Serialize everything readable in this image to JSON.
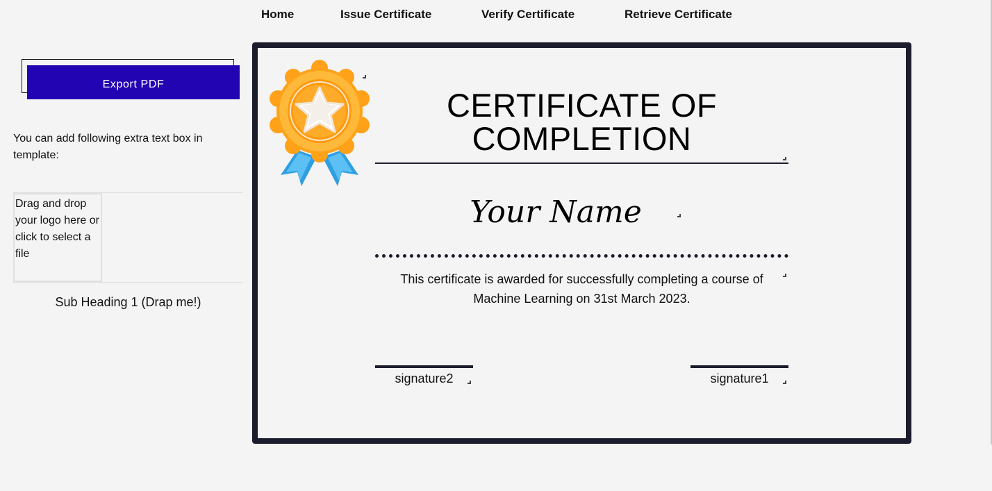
{
  "nav": {
    "home": "Home",
    "issue": "Issue Certificate",
    "verify": "Verify Certificate",
    "retrieve": "Retrieve Certificate"
  },
  "sidebar": {
    "export_label": "Export PDF",
    "note": "You can add following extra text box in template:",
    "dropzone_text": "Drag and drop your logo here or click to select a file",
    "subheading": "Sub Heading 1 (Drap me!)"
  },
  "certificate": {
    "badge_icon": "medal-star-badge",
    "title": "CERTIFICATE OF COMPLETION",
    "name": "Your Name",
    "body": "This certificate is awarded for successfully completing a course of Machine Learning on 31st March 2023.",
    "signature_left": "signature2",
    "signature_right": "signature1"
  },
  "colors": {
    "accent_button": "#2304b3",
    "frame": "#1b1c2c",
    "background": "#f4f4f4",
    "medal_orange": "#ffa41c",
    "ribbon_blue": "#2fa3e6"
  }
}
